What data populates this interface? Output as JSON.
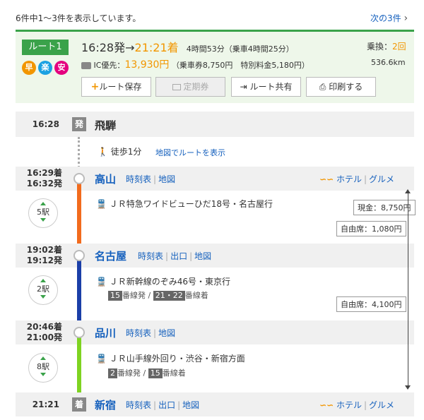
{
  "header": {
    "result_text": "6件中1～3件を表示しています。",
    "next_link": "次の3件",
    "next_chevron": "›"
  },
  "summary": {
    "route_label": "ルート1",
    "icons": [
      {
        "label": "早",
        "color": "#f29600"
      },
      {
        "label": "楽",
        "color": "#1ba1e2"
      },
      {
        "label": "安",
        "color": "#e4007f"
      }
    ],
    "dep_time": "16:28発",
    "arrow": "→",
    "arr_time": "21:21着",
    "duration": "4時間53分（乗車4時間25分）",
    "transfer_label": "乗換：",
    "transfer_count": "2回",
    "ic_label": "IC優先：",
    "fare": "13,930円",
    "fare_detail": "（乗車券8,750円　特別料金5,180円）",
    "distance": "536.6km",
    "buttons": {
      "save": "ルート保存",
      "teiki": "定期券",
      "share": "ルート共有",
      "print": "印刷する"
    }
  },
  "route": {
    "origin": {
      "time": "16:28",
      "badge": "発",
      "name": "飛騨"
    },
    "walk": {
      "text": "徒歩1分",
      "map_link": "地図でルートを表示"
    },
    "stations": [
      {
        "arr": "16:29着",
        "dep": "16:32発",
        "name": "高山",
        "links": [
          "時刻表",
          "地図"
        ],
        "hotel": "ホテル",
        "gourmet": "グルメ"
      },
      {
        "arr": "19:02着",
        "dep": "19:12発",
        "name": "名古屋",
        "links": [
          "時刻表",
          "出口",
          "地図"
        ]
      },
      {
        "arr": "20:46着",
        "dep": "21:00発",
        "name": "品川",
        "links": [
          "時刻表",
          "地図"
        ]
      }
    ],
    "segments": [
      {
        "stops": "5駅",
        "train": "ＪＲ特急ワイドビューひだ18号・名古屋行",
        "color": "#f26b1d",
        "fare_cash": "現金：8,750円",
        "fare_seat": "自由席：1,080円"
      },
      {
        "stops": "2駅",
        "train": "ＪＲ新幹線のぞみ46号・東京行",
        "color": "#1b3fa8",
        "dep_track": "15",
        "dep_track_suffix": "番線発",
        "arr_track": "21・22",
        "arr_track_suffix": "番線着",
        "fare_seat": "自由席：4,100円"
      },
      {
        "stops": "8駅",
        "train": "ＪＲ山手線外回り・渋谷・新宿方面",
        "color": "#7ed321",
        "dep_track": "2",
        "dep_track_suffix": "番線発",
        "arr_track": "15",
        "arr_track_suffix": "番線着"
      }
    ],
    "destination": {
      "time": "21:21",
      "badge": "着",
      "name": "新宿",
      "links": [
        "時刻表",
        "出口",
        "地図"
      ],
      "hotel": "ホテル",
      "gourmet": "グルメ"
    }
  }
}
